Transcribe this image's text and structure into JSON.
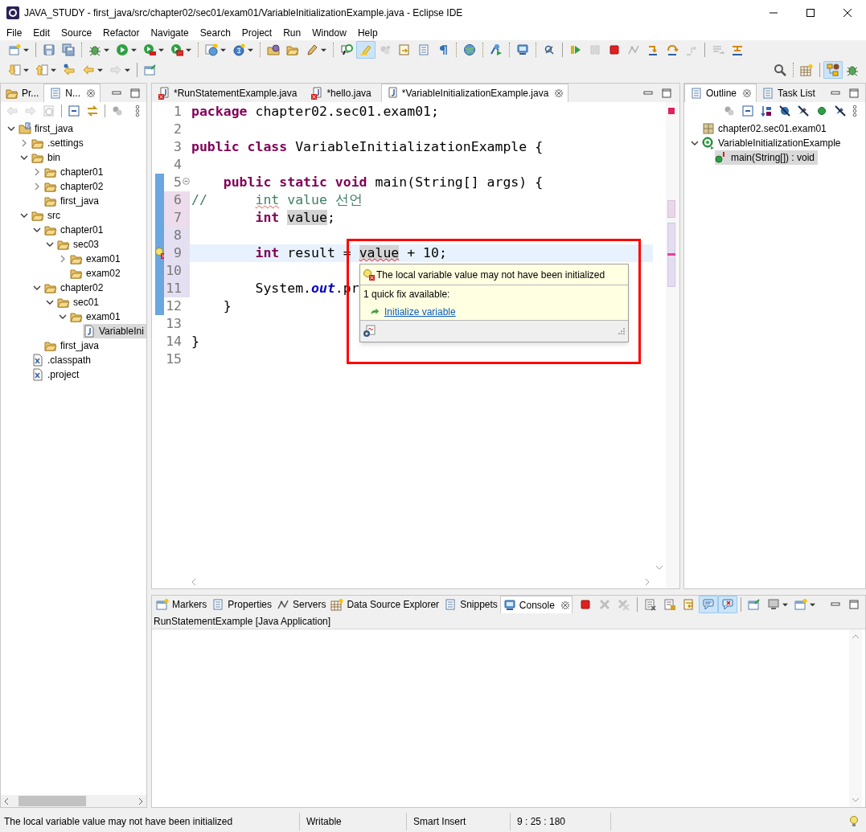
{
  "window": {
    "title": "JAVA_STUDY - first_java/src/chapter02/sec01/exam01/VariableInitializationExample.java - Eclipse IDE"
  },
  "menu": [
    "File",
    "Edit",
    "Source",
    "Refactor",
    "Navigate",
    "Search",
    "Project",
    "Run",
    "Window",
    "Help"
  ],
  "toolbar": {
    "main": [
      {
        "pressed": false,
        "disabled": false
      },
      {
        "pressed": false,
        "disabled": false
      },
      {
        "pressed": false,
        "disabled": false
      },
      {
        "pressed": false,
        "disabled": false
      },
      {
        "pressed": false,
        "disabled": false
      },
      {
        "pressed": false,
        "disabled": false
      },
      {
        "pressed": false,
        "disabled": false
      },
      {
        "pressed": false,
        "disabled": false
      },
      {
        "pressed": false,
        "disabled": false
      },
      {
        "pressed": false,
        "disabled": false
      },
      {
        "pressed": false,
        "disabled": false
      },
      {
        "pressed": false,
        "disabled": false
      },
      {
        "pressed": false,
        "disabled": false
      },
      {
        "pressed": true,
        "disabled": false
      },
      {
        "pressed": false,
        "disabled": true
      },
      {
        "pressed": false,
        "disabled": false
      },
      {
        "pressed": false,
        "disabled": false
      },
      {
        "pressed": false,
        "disabled": false
      },
      {
        "pressed": false,
        "disabled": false
      },
      {
        "pressed": false,
        "disabled": false
      },
      {
        "pressed": false,
        "disabled": false
      },
      {
        "pressed": false,
        "disabled": false
      },
      {
        "pressed": false,
        "disabled": false
      },
      {
        "pressed": false,
        "disabled": true
      },
      {
        "pressed": false,
        "disabled": false
      },
      {
        "pressed": false,
        "disabled": true
      },
      {
        "pressed": false,
        "disabled": false
      },
      {
        "pressed": false,
        "disabled": false
      },
      {
        "pressed": false,
        "disabled": true
      },
      {
        "pressed": false,
        "disabled": true
      },
      {
        "pressed": false,
        "disabled": false
      }
    ],
    "navigation": [
      {
        "pressed": false,
        "disabled": false
      },
      {
        "pressed": false,
        "disabled": false
      },
      {
        "pressed": false,
        "disabled": false
      },
      {
        "pressed": false,
        "disabled": false
      },
      {
        "pressed": false,
        "disabled": true
      },
      {
        "pressed": false,
        "disabled": false
      }
    ],
    "perspectives": [
      {
        "pressed": false,
        "disabled": false
      },
      {
        "pressed": false,
        "disabled": false
      },
      {
        "pressed": true,
        "disabled": false
      },
      {
        "pressed": false,
        "disabled": false
      }
    ]
  },
  "explorer": {
    "tabs": [
      {
        "label": "Pr...",
        "selected": false
      },
      {
        "label": "N...",
        "selected": true
      }
    ],
    "tree": [
      {
        "label": "first_java",
        "kind": "project",
        "expanded": true,
        "selected": false,
        "children": [
          {
            "label": ".settings",
            "kind": "folder",
            "expanded": false,
            "selected": false
          },
          {
            "label": "bin",
            "kind": "folder",
            "expanded": true,
            "selected": false,
            "children": [
              {
                "label": "chapter01",
                "kind": "folder",
                "expanded": false,
                "selected": false
              },
              {
                "label": "chapter02",
                "kind": "folder",
                "expanded": false,
                "selected": false
              },
              {
                "label": "first_java",
                "kind": "folder",
                "selected": false
              }
            ]
          },
          {
            "label": "src",
            "kind": "folder",
            "expanded": true,
            "selected": false,
            "children": [
              {
                "label": "chapter01",
                "kind": "folder",
                "expanded": true,
                "selected": false,
                "children": [
                  {
                    "label": "sec03",
                    "kind": "folder",
                    "expanded": true,
                    "selected": false,
                    "children": [
                      {
                        "label": "exam01",
                        "kind": "folder",
                        "expanded": false,
                        "selected": false
                      },
                      {
                        "label": "exam02",
                        "kind": "folder",
                        "selected": false
                      }
                    ]
                  }
                ]
              },
              {
                "label": "chapter02",
                "kind": "folder",
                "expanded": true,
                "selected": false,
                "children": [
                  {
                    "label": "sec01",
                    "kind": "folder",
                    "expanded": true,
                    "selected": false,
                    "children": [
                      {
                        "label": "exam01",
                        "kind": "folder",
                        "expanded": true,
                        "selected": false,
                        "children": [
                          {
                            "label": "VariableIni",
                            "kind": "java",
                            "selected": true
                          }
                        ]
                      }
                    ]
                  }
                ]
              },
              {
                "label": "first_java",
                "kind": "folder",
                "selected": false
              }
            ]
          },
          {
            "label": ".classpath",
            "kind": "xml",
            "selected": false
          },
          {
            "label": ".project",
            "kind": "xml",
            "selected": false
          }
        ]
      }
    ]
  },
  "editor": {
    "tabs": [
      {
        "label": "*RunStatementExample.java",
        "selected": false,
        "error": true
      },
      {
        "label": "*hello.java",
        "selected": false,
        "error": true
      },
      {
        "label": "*VariableInitializationExample.java",
        "selected": true,
        "error": false
      }
    ],
    "lines": [
      {
        "number": "1",
        "tokens": [
          {
            "text": "package",
            "kind": "keyword"
          },
          {
            "text": " chapter02.sec01.exam01;",
            "kind": "text"
          }
        ],
        "range": false,
        "changed": false,
        "added": false,
        "current": false,
        "error": false,
        "fold": false
      },
      {
        "number": "2",
        "range": false,
        "changed": false,
        "added": false,
        "current": false,
        "error": false,
        "fold": false
      },
      {
        "number": "3",
        "tokens": [
          {
            "text": "public class",
            "kind": "keyword"
          },
          {
            "text": " VariableInitializationExample {",
            "kind": "text"
          }
        ],
        "range": false,
        "changed": false,
        "added": false,
        "current": false,
        "error": false,
        "fold": false
      },
      {
        "number": "4",
        "range": false,
        "changed": false,
        "added": false,
        "current": false,
        "error": false,
        "fold": false
      },
      {
        "number": "5",
        "tokens": [
          {
            "text": "    public static void",
            "kind": "keyword"
          },
          {
            "text": " main(String[] args) {",
            "kind": "text"
          }
        ],
        "range": true,
        "changed": false,
        "added": false,
        "current": false,
        "error": false,
        "fold": true
      },
      {
        "number": "6",
        "tokens": [
          {
            "text": "//      ",
            "kind": "comment"
          },
          {
            "text": "int",
            "kind": "comment-misspelled"
          },
          {
            "text": " value 선언",
            "kind": "comment"
          }
        ],
        "range": true,
        "changed": true,
        "added": false,
        "current": false,
        "error": false,
        "fold": false
      },
      {
        "number": "7",
        "tokens": [
          {
            "text": "        int ",
            "kind": "keyword"
          },
          {
            "text": "value",
            "kind": "occurrence"
          },
          {
            "text": ";",
            "kind": "text"
          }
        ],
        "range": true,
        "changed": true,
        "added": false,
        "current": false,
        "error": false,
        "fold": false
      },
      {
        "number": "8",
        "range": true,
        "changed": false,
        "added": true,
        "current": false,
        "error": false,
        "fold": false
      },
      {
        "number": "9",
        "tokens": [
          {
            "text": "        int",
            "kind": "keyword"
          },
          {
            "text": " result = ",
            "kind": "text"
          },
          {
            "text": "value",
            "kind": "occurrence-error"
          },
          {
            "text": " + 10;",
            "kind": "text"
          }
        ],
        "range": true,
        "changed": false,
        "added": true,
        "current": true,
        "error": true,
        "fold": false
      },
      {
        "number": "10",
        "range": true,
        "changed": false,
        "added": true,
        "current": false,
        "error": false,
        "fold": false
      },
      {
        "number": "11",
        "tokens": [
          {
            "text": "        System.",
            "kind": "text"
          },
          {
            "text": "out",
            "kind": "field"
          },
          {
            "text": ".pr",
            "kind": "text"
          }
        ],
        "range": true,
        "changed": false,
        "added": true,
        "current": false,
        "error": false,
        "fold": false
      },
      {
        "number": "12",
        "tokens": [
          {
            "text": "    }",
            "kind": "text"
          }
        ],
        "range": true,
        "changed": false,
        "added": false,
        "current": false,
        "error": false,
        "fold": false
      },
      {
        "number": "13",
        "range": false,
        "changed": false,
        "added": false,
        "current": false,
        "error": false,
        "fold": false
      },
      {
        "number": "14",
        "tokens": [
          {
            "text": "}",
            "kind": "text"
          }
        ],
        "range": false,
        "changed": false,
        "added": false,
        "current": false,
        "error": false,
        "fold": false
      },
      {
        "number": "15",
        "range": false,
        "changed": false,
        "added": false,
        "current": false,
        "error": false,
        "fold": false
      }
    ],
    "hover": {
      "message": "The local variable value may not have been initialized",
      "fix_count": "1 quick fix available:",
      "fix": "Initialize variable"
    }
  },
  "outline": {
    "tabs": [
      {
        "label": "Outline",
        "selected": true
      },
      {
        "label": "Task List",
        "selected": false
      }
    ],
    "tree": [
      {
        "label": "chapter02.sec01.exam01",
        "kind": "package",
        "selected": false
      },
      {
        "label": "VariableInitializationExample",
        "kind": "class",
        "expanded": true,
        "selected": false,
        "children": [
          {
            "label": "main(String[]) : void",
            "kind": "method",
            "selected": true
          }
        ]
      }
    ]
  },
  "console_view": {
    "tabs": [
      {
        "label": "Markers",
        "selected": false
      },
      {
        "label": "Properties",
        "selected": false
      },
      {
        "label": "Servers",
        "selected": false
      },
      {
        "label": "Data Source Explorer",
        "selected": false
      },
      {
        "label": "Snippets",
        "selected": false
      },
      {
        "label": "Console",
        "selected": true
      }
    ],
    "toolbar": [
      {
        "pressed": false,
        "disabled": false
      },
      {
        "pressed": false,
        "disabled": true
      },
      {
        "pressed": false,
        "disabled": true
      },
      {
        "pressed": false,
        "disabled": false
      },
      {
        "pressed": false,
        "disabled": false
      },
      {
        "pressed": false,
        "disabled": false
      },
      {
        "pressed": true,
        "disabled": false
      },
      {
        "pressed": true,
        "disabled": false
      },
      {
        "pressed": false,
        "disabled": false
      },
      {
        "pressed": false,
        "disabled": false
      },
      {
        "pressed": false,
        "disabled": false
      }
    ],
    "label": "RunStatementExample [Java Application]"
  },
  "status_bar": {
    "message": "The local variable value may not have been initialized",
    "mode": "Writable",
    "insert": "Smart Insert",
    "position": "9 : 25 : 180"
  }
}
